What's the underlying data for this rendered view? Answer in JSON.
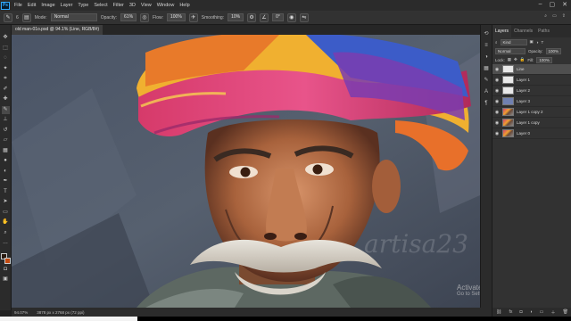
{
  "menu": {
    "logo": "Ps",
    "items": [
      "File",
      "Edit",
      "Image",
      "Layer",
      "Type",
      "Select",
      "Filter",
      "3D",
      "View",
      "Window",
      "Help"
    ],
    "window_controls": [
      "–",
      "▢",
      "✕"
    ]
  },
  "options_bar": {
    "mode_label": "Mode:",
    "mode_value": "Normal",
    "opacity_label": "Opacity:",
    "opacity_value": "61%",
    "flow_label": "Flow:",
    "flow_value": "100%",
    "smoothing_label": "Smoothing:",
    "smoothing_value": "10%",
    "angle_value": "0°",
    "brush_size": "6"
  },
  "document_tab": {
    "title": "old man-01o.psd @ 94.1% (Line, RGB/8#)"
  },
  "status_bar": {
    "zoom": "94.07%",
    "doc_size": "3878 px x 2768 px (72 ppi)"
  },
  "canvas": {
    "watermark": "artisa23",
    "activate_title": "Activate Windows",
    "activate_sub": "Go to Settings to activate Windows."
  },
  "layers_panel": {
    "tabs": [
      "Layers",
      "Channels",
      "Paths"
    ],
    "active_tab": "Layers",
    "kind_label": "Kind",
    "blend_mode": "Normal",
    "opacity_label": "Opacity:",
    "opacity_value": "100%",
    "lock_label": "Lock:",
    "fill_label": "Fill:",
    "fill_value": "100%",
    "layers": [
      {
        "name": "Line",
        "thumb": "white",
        "selected": true
      },
      {
        "name": "Layer 1",
        "thumb": "white",
        "selected": false
      },
      {
        "name": "Layer 2",
        "thumb": "white",
        "selected": false
      },
      {
        "name": "Layer 3",
        "thumb": "blue",
        "selected": false
      },
      {
        "name": "Layer 1 copy 2",
        "thumb": "photo",
        "selected": false
      },
      {
        "name": "Layer 1 copy",
        "thumb": "photo",
        "selected": false
      },
      {
        "name": "Layer 0",
        "thumb": "photo",
        "selected": false
      }
    ]
  },
  "tools": [
    "move-icon",
    "marquee-icon",
    "lasso-icon",
    "magic-wand-icon",
    "crop-icon",
    "eyedropper-icon",
    "healing-icon",
    "brush-icon",
    "clone-stamp-icon",
    "history-brush-icon",
    "eraser-icon",
    "gradient-icon",
    "blur-icon",
    "dodge-icon",
    "pen-icon",
    "type-icon",
    "path-select-icon",
    "shape-icon",
    "hand-icon",
    "zoom-icon"
  ],
  "colors": {
    "foreground": "#2a1a10",
    "background": "#c24a10"
  }
}
